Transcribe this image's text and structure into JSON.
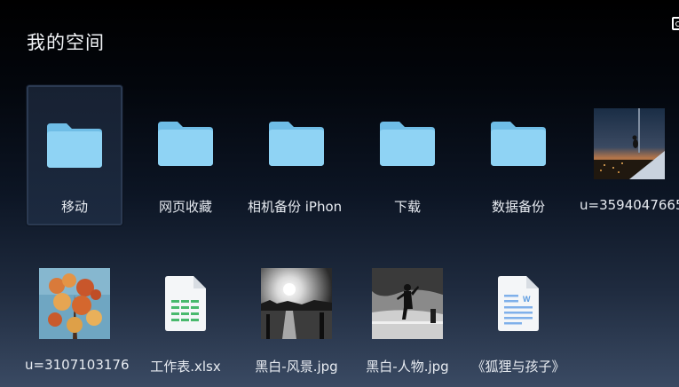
{
  "header": {
    "title": "我的空间"
  },
  "items_row1": [
    {
      "label": "移动",
      "icon": "folder-icon",
      "selected": true
    },
    {
      "label": "网页收藏",
      "icon": "folder-icon"
    },
    {
      "label": "相机备份 iPhon",
      "icon": "folder-icon"
    },
    {
      "label": "下载",
      "icon": "folder-icon"
    },
    {
      "label": "数据备份",
      "icon": "folder-icon"
    },
    {
      "label": "u=3594047665",
      "icon": "photo-thumbnail"
    }
  ],
  "items_row2": [
    {
      "label": "u=3107103176",
      "icon": "photo-thumbnail"
    },
    {
      "label": "工作表.xlsx",
      "icon": "spreadsheet-file-icon"
    },
    {
      "label": "黑白-风景.jpg",
      "icon": "photo-thumbnail"
    },
    {
      "label": "黑白-人物.jpg",
      "icon": "photo-thumbnail"
    },
    {
      "label": "《狐狸与孩子》",
      "icon": "word-document-icon"
    }
  ],
  "colors": {
    "folder": "#8fd3f4",
    "folder_dark": "#6fbde6",
    "spreadsheet": "#3fb96a",
    "word": "#5b9be0"
  }
}
